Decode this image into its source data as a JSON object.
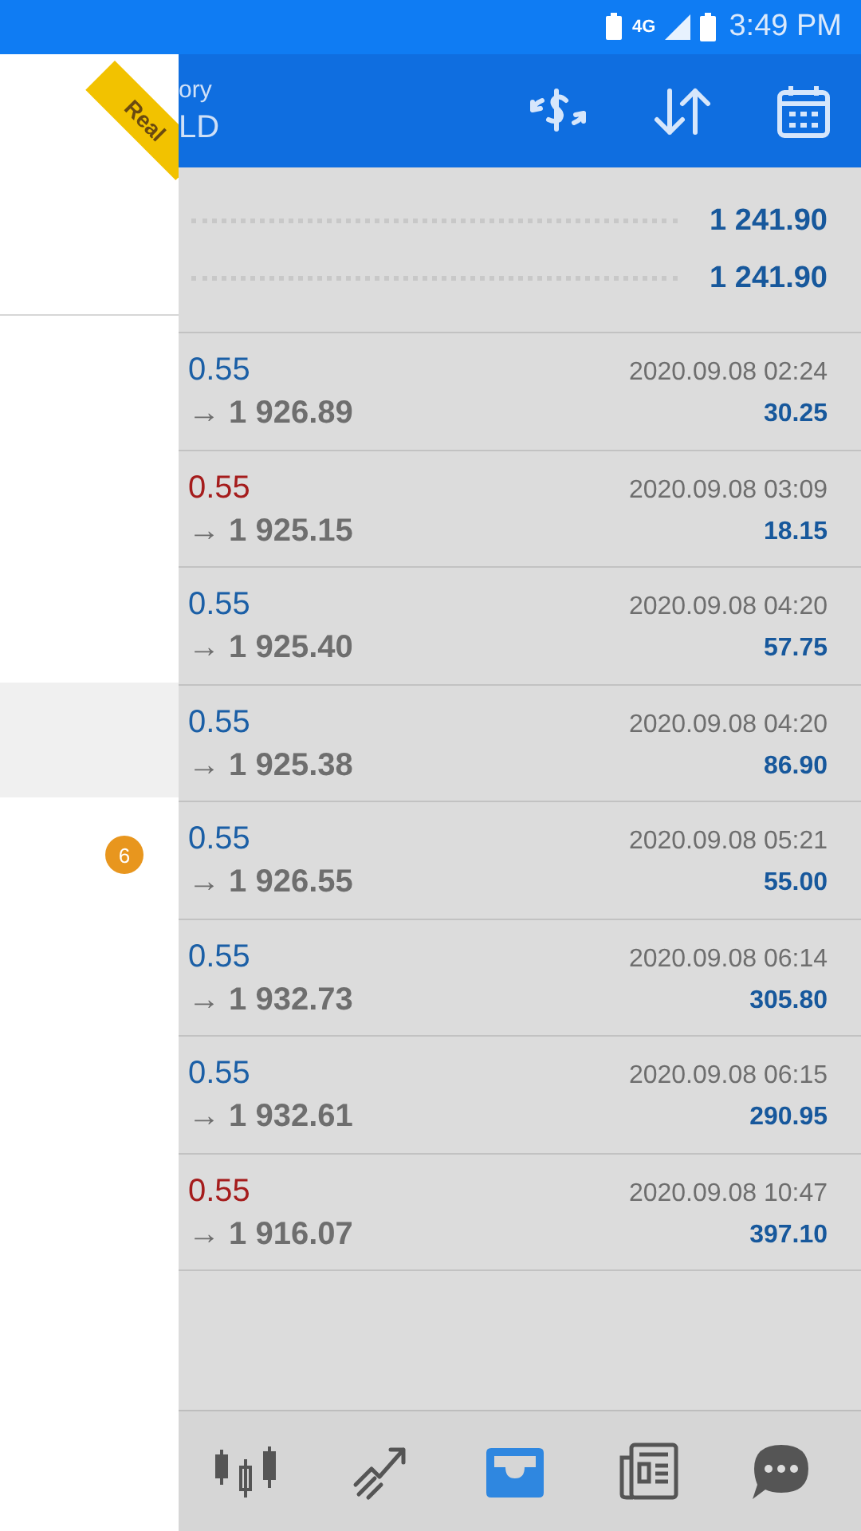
{
  "status_bar": {
    "network": "4G",
    "time": "3:49 PM"
  },
  "drawer": {
    "ribbon": "Real",
    "rows": [
      {
        "selected": true
      },
      {
        "selected": false,
        "badge": "6"
      }
    ]
  },
  "header": {
    "title": "ory",
    "subtitle": "LD"
  },
  "summary": [
    "1 241.90",
    "1 241.90"
  ],
  "trades": [
    {
      "kind": "buy",
      "lots": "0.55",
      "price": "→ 1 926.89",
      "time": "2020.09.08 02:24",
      "profit": "30.25"
    },
    {
      "kind": "sell",
      "lots": "0.55",
      "price": "→ 1 925.15",
      "time": "2020.09.08 03:09",
      "profit": "18.15"
    },
    {
      "kind": "buy",
      "lots": "0.55",
      "price": "→ 1 925.40",
      "time": "2020.09.08 04:20",
      "profit": "57.75"
    },
    {
      "kind": "buy",
      "lots": "0.55",
      "price": "→ 1 925.38",
      "time": "2020.09.08 04:20",
      "profit": "86.90"
    },
    {
      "kind": "buy",
      "lots": "0.55",
      "price": "→ 1 926.55",
      "time": "2020.09.08 05:21",
      "profit": "55.00"
    },
    {
      "kind": "buy",
      "lots": "0.55",
      "price": "→ 1 932.73",
      "time": "2020.09.08 06:14",
      "profit": "305.80"
    },
    {
      "kind": "buy",
      "lots": "0.55",
      "price": "→ 1 932.61",
      "time": "2020.09.08 06:15",
      "profit": "290.95"
    },
    {
      "kind": "sell",
      "lots": "0.55",
      "price": "→ 1 916.07",
      "time": "2020.09.08 10:47",
      "profit": "397.10"
    }
  ],
  "nav": [
    {
      "kind": "quotes",
      "selected": false
    },
    {
      "kind": "trade",
      "selected": false
    },
    {
      "kind": "history",
      "selected": true
    },
    {
      "kind": "news",
      "selected": false
    },
    {
      "kind": "chat",
      "selected": false
    }
  ]
}
